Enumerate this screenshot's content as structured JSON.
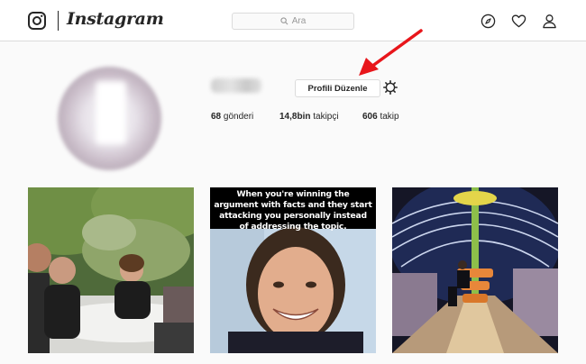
{
  "app": {
    "name": "Instagram"
  },
  "search": {
    "placeholder": "Ara"
  },
  "nav": {
    "icons": [
      "compass-icon",
      "heart-icon",
      "user-icon"
    ]
  },
  "profile": {
    "edit_button": "Profili Düzenle",
    "stats": {
      "posts_count": "68",
      "posts_label": "gönderi",
      "followers_count": "14,8bin",
      "followers_label": "takipçi",
      "following_count": "606",
      "following_label": "takip"
    }
  },
  "posts": [
    {
      "caption_text": ""
    },
    {
      "caption_text": "When you're winning the argument with facts and they start attacking you personally instead of addressing the topic."
    },
    {
      "caption_text": ""
    }
  ],
  "colors": {
    "annotation_arrow": "#e8161b",
    "border": "#dbdbdb",
    "background": "#fafafa"
  }
}
